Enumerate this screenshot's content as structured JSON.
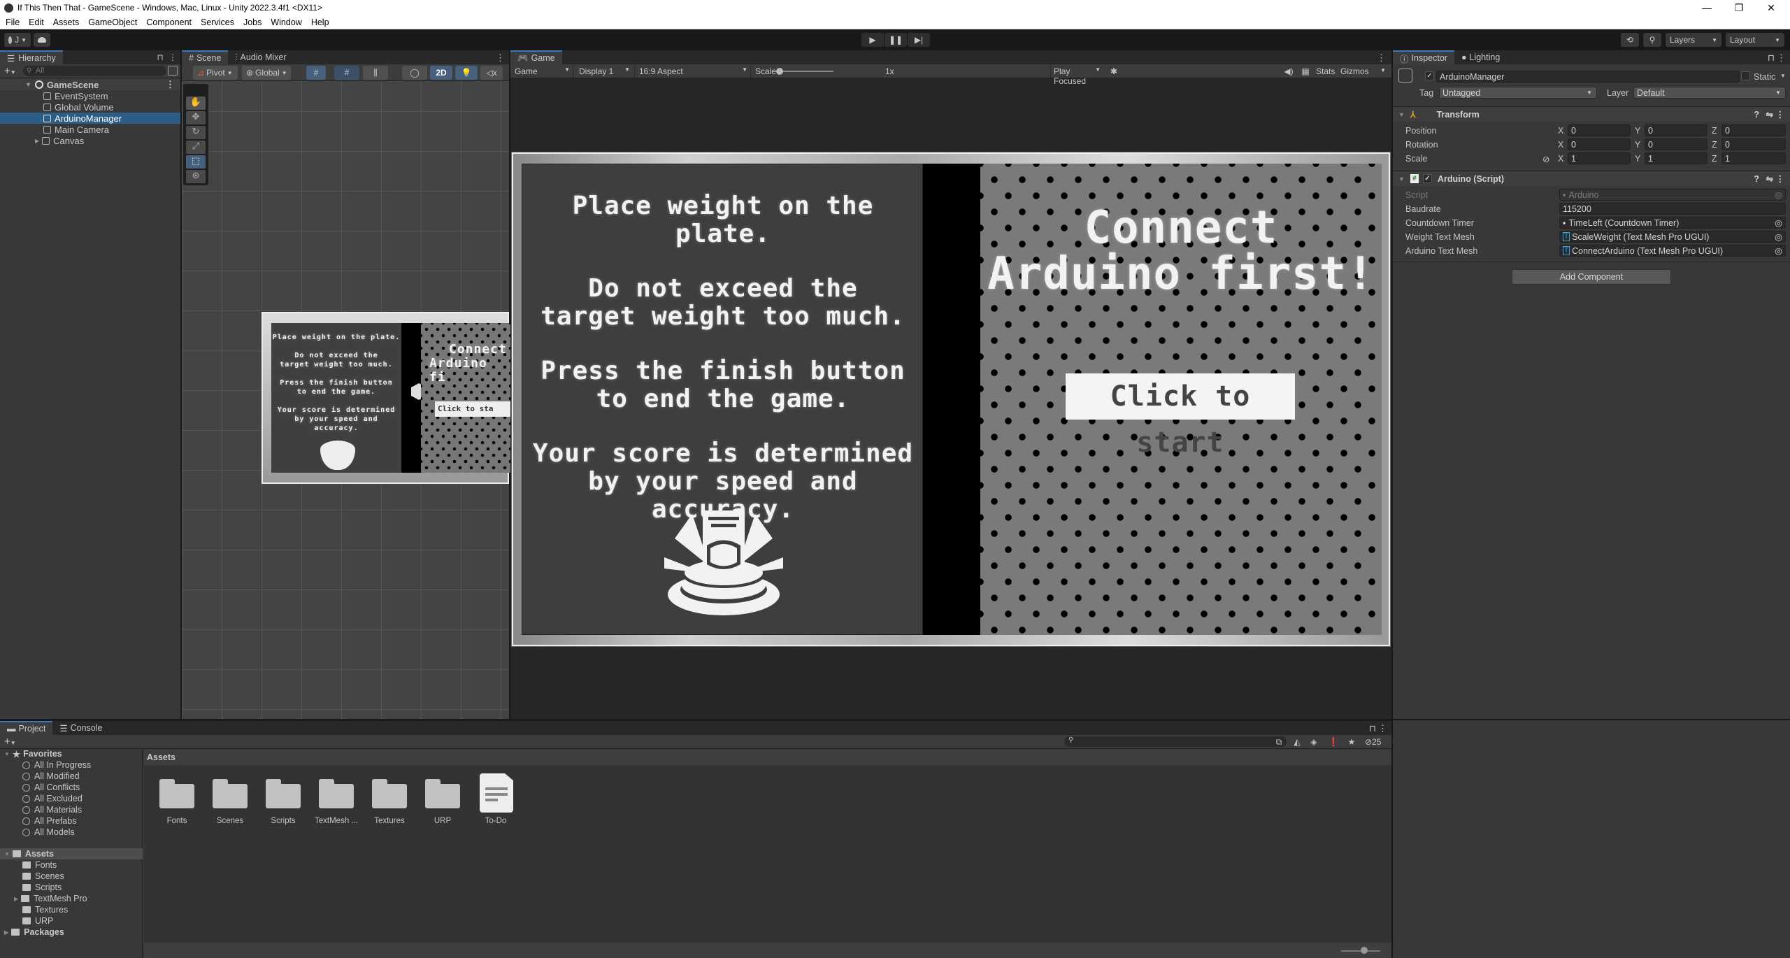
{
  "window": {
    "title": "If This Then That - GameScene - Windows, Mac, Linux - Unity 2022.3.4f1 <DX11>",
    "minimize": "—",
    "restore": "❐",
    "close": "✕"
  },
  "menu": [
    "File",
    "Edit",
    "Assets",
    "GameObject",
    "Component",
    "Services",
    "Jobs",
    "Window",
    "Help"
  ],
  "toolbar": {
    "account": "J",
    "layers": "Layers",
    "layout": "Layout"
  },
  "hierarchy": {
    "tab": "Hierarchy",
    "search_placeholder": "All",
    "scene": "GameScene",
    "items": [
      {
        "label": "EventSystem"
      },
      {
        "label": "Global Volume"
      },
      {
        "label": "ArduinoManager",
        "selected": true
      },
      {
        "label": "Main Camera"
      },
      {
        "label": "Canvas",
        "expandable": true
      }
    ]
  },
  "scene_view": {
    "tabs": [
      "Scene",
      "Audio Mixer"
    ],
    "pivot": "Pivot",
    "global": "Global",
    "mode_2d": "2D",
    "thumb": {
      "line1": "Place weight on the plate.",
      "line2": "Do not exceed the",
      "line3": "target weight too much.",
      "line4": "Press the finish button",
      "line5": "to end the game.",
      "line6": "Your score is determined",
      "line7": "by your speed and accuracy.",
      "connect": "Connect",
      "arduino": "Arduino fi",
      "click": "Click to sta"
    }
  },
  "game_view": {
    "tab": "Game",
    "mode": "Game",
    "display": "Display 1",
    "aspect": "16:9 Aspect",
    "scale_label": "Scale",
    "scale_value": "1x",
    "play_mode": "Play Focused",
    "stats": "Stats",
    "gizmos": "Gizmos",
    "instructions": [
      "Place weight on the plate.",
      "",
      "Do not exceed the",
      "target weight too much.",
      "",
      "Press the finish button",
      "to end the game.",
      "",
      "Your score is determined",
      "by your speed and accuracy."
    ],
    "connect_line1": "Connect",
    "connect_line2": "Arduino first!",
    "start_button": "Click to start"
  },
  "inspector": {
    "tabs": [
      "Inspector",
      "Lighting"
    ],
    "object_name": "ArduinoManager",
    "static_label": "Static",
    "tag_label": "Tag",
    "tag_value": "Untagged",
    "layer_label": "Layer",
    "layer_value": "Default",
    "transform": {
      "title": "Transform",
      "position": {
        "label": "Position",
        "x": "0",
        "y": "0",
        "z": "0"
      },
      "rotation": {
        "label": "Rotation",
        "x": "0",
        "y": "0",
        "z": "0"
      },
      "scale": {
        "label": "Scale",
        "x": "1",
        "y": "1",
        "z": "1"
      }
    },
    "script": {
      "title": "Arduino (Script)",
      "fields": [
        {
          "label": "Script",
          "value": "Arduino"
        },
        {
          "label": "Baudrate",
          "value": "115200"
        },
        {
          "label": "Countdown Timer",
          "value": "TimeLeft (Countdown Timer)"
        },
        {
          "label": "Weight Text Mesh",
          "value": "ScaleWeight (Text Mesh Pro UGUI)"
        },
        {
          "label": "Arduino Text Mesh",
          "value": "ConnectArduino (Text Mesh Pro UGUI)"
        }
      ]
    },
    "add_component": "Add Component"
  },
  "project": {
    "tabs": [
      "Project",
      "Console"
    ],
    "favorites_label": "Favorites",
    "favorites": [
      "All In Progress",
      "All Modified",
      "All Conflicts",
      "All Excluded",
      "All Materials",
      "All Prefabs",
      "All Models"
    ],
    "assets_label": "Assets",
    "asset_tree": [
      "Fonts",
      "Scenes",
      "Scripts",
      "TextMesh Pro",
      "Textures",
      "URP"
    ],
    "packages_label": "Packages",
    "breadcrumb": "Assets",
    "grid": [
      "Fonts",
      "Scenes",
      "Scripts",
      "TextMesh ...",
      "Textures",
      "URP",
      "To-Do"
    ],
    "hidden_count": "25"
  }
}
